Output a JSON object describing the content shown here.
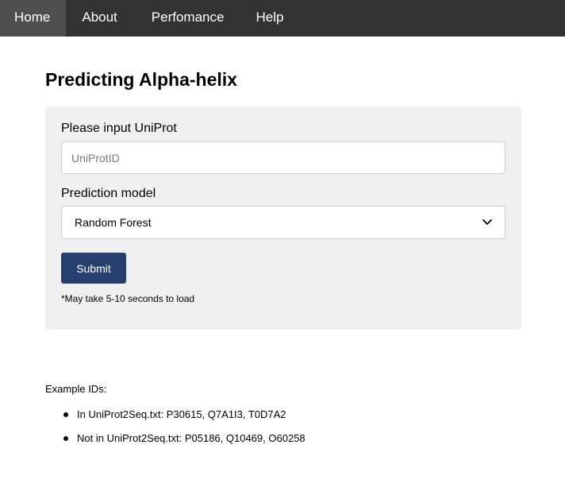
{
  "nav": {
    "items": [
      {
        "label": "Home"
      },
      {
        "label": "About"
      },
      {
        "label": "Perfomance"
      },
      {
        "label": "Help"
      }
    ]
  },
  "page": {
    "title": "Predicting Alpha-helix"
  },
  "form": {
    "uniprot_label": "Please input UniProt",
    "uniprot_placeholder": "UniProtID",
    "model_label": "Prediction model",
    "model_selected": "Random Forest",
    "submit_label": "Submit",
    "note": "*May take 5-10 seconds to load"
  },
  "examples": {
    "heading": "Example IDs:",
    "items": [
      {
        "text": "In UniProt2Seq.txt: P30615, Q7A1I3, T0D7A2"
      },
      {
        "text": "Not in UniProt2Seq.txt: P05186, Q10469, O60258"
      }
    ]
  },
  "colors": {
    "nav_bg": "#333333",
    "nav_active": "#4f4f4f",
    "panel_bg": "#f0f0f0",
    "submit_bg": "#263f6e"
  }
}
